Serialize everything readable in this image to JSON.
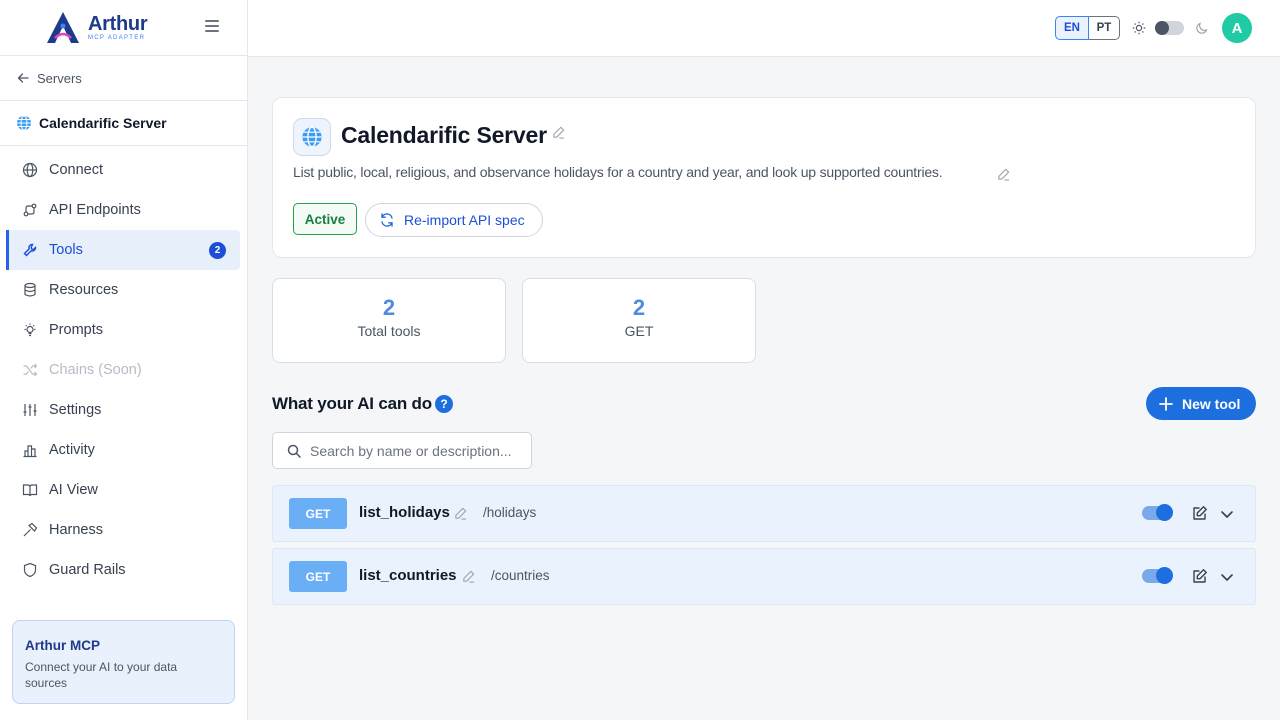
{
  "brand": {
    "name": "Arthur",
    "subtitle": "MCP ADAPTER"
  },
  "sidebar": {
    "back_label": "Servers",
    "server_name": "Calendarific Server",
    "items": [
      {
        "label": "Connect",
        "icon": "globe-icon"
      },
      {
        "label": "API Endpoints",
        "icon": "endpoints-icon"
      },
      {
        "label": "Tools",
        "icon": "wrench-icon",
        "active": true,
        "badge": "2"
      },
      {
        "label": "Resources",
        "icon": "database-icon"
      },
      {
        "label": "Prompts",
        "icon": "lightbulb-icon"
      },
      {
        "label": "Chains (Soon)",
        "icon": "shuffle-icon",
        "disabled": true
      },
      {
        "label": "Settings",
        "icon": "sliders-icon"
      },
      {
        "label": "Activity",
        "icon": "bar-chart-icon"
      },
      {
        "label": "AI View",
        "icon": "book-open-icon"
      },
      {
        "label": "Harness",
        "icon": "hammer-icon"
      },
      {
        "label": "Guard Rails",
        "icon": "shield-icon"
      }
    ],
    "promo": {
      "title": "Arthur MCP",
      "text": "Connect your AI to your data sources"
    }
  },
  "topbar": {
    "languages": [
      "EN",
      "PT"
    ],
    "active_language": "EN",
    "dark_mode": false,
    "avatar_initial": "A",
    "avatar_color": "#1fcba5"
  },
  "server": {
    "title": "Calendarific Server",
    "description": "List public, local, religious, and observance holidays for a country and year, and look up supported countries.",
    "status": "Active",
    "reimport_label": "Re-import API spec"
  },
  "stats": [
    {
      "value": "2",
      "label": "Total tools"
    },
    {
      "value": "2",
      "label": "GET"
    }
  ],
  "tools_section": {
    "title": "What your AI can do",
    "help": "?",
    "new_tool_label": "New tool",
    "search_placeholder": "Search by name or description..."
  },
  "tools": [
    {
      "method": "GET",
      "name": "list_holidays",
      "path": "/holidays",
      "enabled": true
    },
    {
      "method": "GET",
      "name": "list_countries",
      "path": "/countries",
      "enabled": true
    }
  ],
  "colors": {
    "accent": "#1d6fe0",
    "active_green": "#15803d",
    "method_badge": "#6aaef5"
  }
}
